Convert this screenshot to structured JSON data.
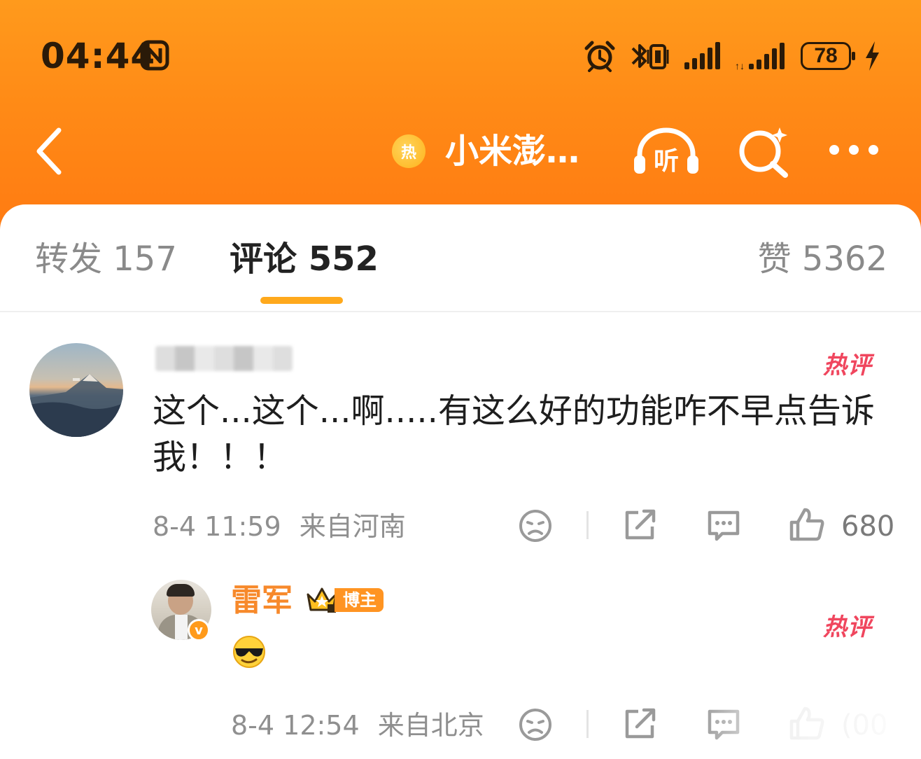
{
  "status_bar": {
    "time": "04:44",
    "battery": "78",
    "icons": [
      "nfc-icon",
      "alarm-icon",
      "bluetooth-vibrate-icon",
      "signal-icon",
      "signal-4g-icon",
      "battery-icon",
      "charging-icon"
    ]
  },
  "nav": {
    "topic_badge": "热",
    "title": "小米澎…",
    "listen_label": "听",
    "icons": [
      "back-arrow-icon",
      "headphones-listen-icon",
      "search-spark-icon",
      "more-icon"
    ]
  },
  "tabs": {
    "repost": "转发 157",
    "comments": "评论 552",
    "likes": "赞 5362"
  },
  "comments": [
    {
      "hot_label": "热评",
      "text": "这个...这个...啊.....有这么好的功能咋不早点告诉我！！！",
      "date": "8-4 11:59",
      "location": "来自河南",
      "like_count": "680"
    }
  ],
  "reply": {
    "author": "雷军",
    "author_badge": "博主",
    "verified_mark": "v",
    "hot_label": "热评",
    "date": "8-4 12:54",
    "location": "来自北京",
    "like_count": "(00"
  },
  "colors": {
    "header": "#ff8a16",
    "accent_underline": "#ffa91c",
    "hot_label": "#f0465e",
    "author_name": "#f7892b"
  }
}
